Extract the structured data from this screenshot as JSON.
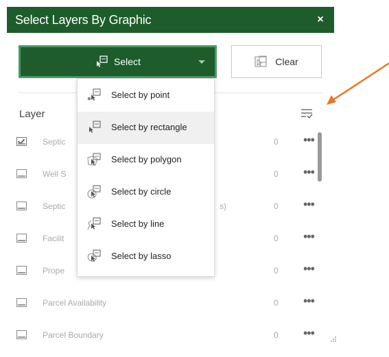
{
  "header": {
    "title": "Select Layers By Graphic",
    "close_glyph": "×"
  },
  "toolbar": {
    "select_label": "Select",
    "clear_label": "Clear"
  },
  "list_header": {
    "column_label": "Layer"
  },
  "layers": [
    {
      "name": "Septic",
      "count": "0",
      "checked": true
    },
    {
      "name": "Well S",
      "count": "0",
      "checked": false
    },
    {
      "name": "Septic",
      "name_tail": "s)",
      "count": "0",
      "checked": false
    },
    {
      "name": "Facilit",
      "count": "0",
      "checked": false
    },
    {
      "name": "Prope",
      "count": "0",
      "checked": false
    },
    {
      "name": "Parcel Availability",
      "count": "0",
      "checked": false
    },
    {
      "name": "Parcel Boundary",
      "count": "0",
      "checked": false
    }
  ],
  "more_glyph": "•••",
  "dropdown": {
    "items": [
      {
        "label": "Select by point",
        "icon": "point-select-icon"
      },
      {
        "label": "Select by rectangle",
        "icon": "rectangle-select-icon",
        "active": true
      },
      {
        "label": "Select by polygon",
        "icon": "polygon-select-icon"
      },
      {
        "label": "Select by circle",
        "icon": "circle-select-icon"
      },
      {
        "label": "Select by line",
        "icon": "line-select-icon"
      },
      {
        "label": "Select by lasso",
        "icon": "lasso-select-icon"
      }
    ]
  },
  "colors": {
    "header_bg": "#1e5c2b",
    "button_border": "#4a9a67",
    "annotation_arrow": "#e87722"
  }
}
